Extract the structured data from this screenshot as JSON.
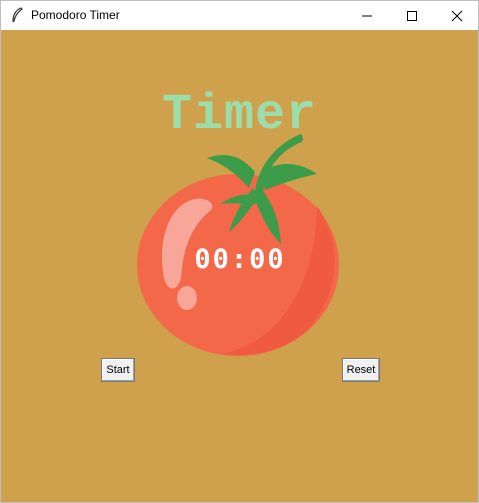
{
  "window": {
    "title": "Pomodoro Timer",
    "icon": "feather-icon",
    "controls": {
      "minimize_icon": "minimize-icon",
      "maximize_icon": "maximize-icon",
      "close_icon": "close-icon"
    }
  },
  "main": {
    "heading": "Timer",
    "time": "00:00",
    "tomato_icon": "tomato-icon",
    "start_label": "Start",
    "reset_label": "Reset"
  },
  "colors": {
    "background": "#cfa14d",
    "heading": "#9bdeac",
    "tomato": "#f26849",
    "leaves": "#3c9c4a",
    "timer_text": "#ffffff"
  }
}
